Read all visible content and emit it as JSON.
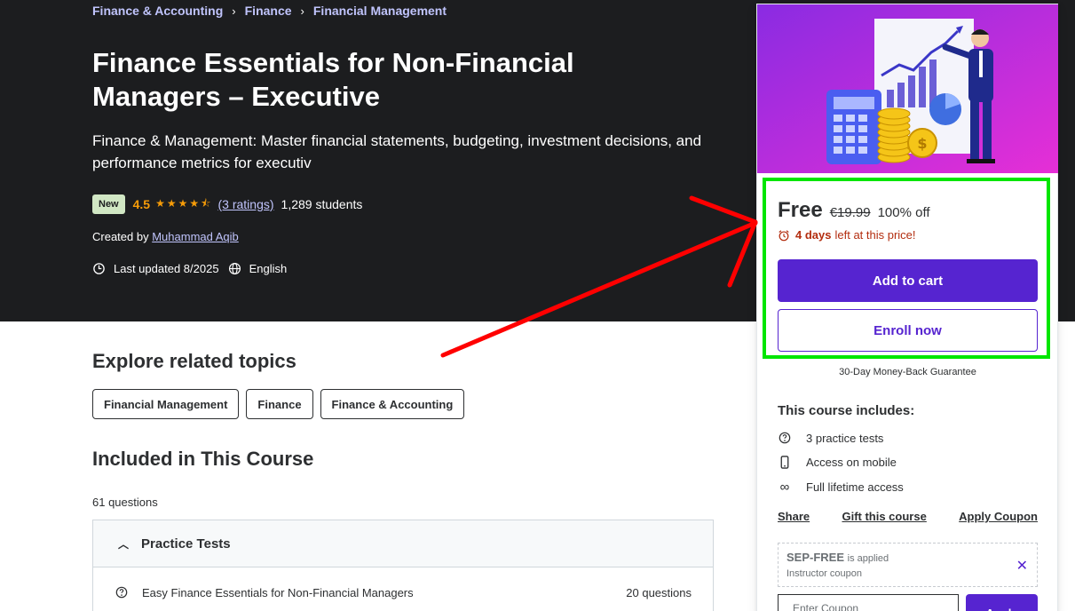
{
  "breadcrumb": [
    "Finance & Accounting",
    "Finance",
    "Financial Management"
  ],
  "course": {
    "title": "Finance Essentials for Non-Financial Managers – Executive",
    "subtitle": "Finance & Management: Master financial statements, budgeting, investment decisions, and performance metrics for executiv",
    "badge": "New",
    "rating": "4.5",
    "rating_stars": 4.5,
    "ratings_link": "(3 ratings)",
    "students": "1,289 students",
    "created_by_label": "Created by",
    "instructor": "Muhammad Aqib",
    "last_updated": "Last updated 8/2025",
    "language": "English"
  },
  "topics": {
    "heading": "Explore related topics",
    "items": [
      "Financial Management",
      "Finance",
      "Finance & Accounting"
    ]
  },
  "included": {
    "heading": "Included in This Course",
    "count": "61 questions",
    "section_title": "Practice Tests",
    "rows": [
      {
        "label": "Easy Finance Essentials for Non-Financial Managers",
        "count": "20 questions"
      }
    ]
  },
  "card": {
    "price": "Free",
    "original_price": "€19.99",
    "discount": "100% off",
    "timer_bold": "4 days",
    "timer_text": "left at this price!",
    "add_to_cart": "Add to cart",
    "enroll": "Enroll now",
    "guarantee": "30-Day Money-Back Guarantee",
    "includes_heading": "This course includes:",
    "includes": [
      {
        "icon": "question-icon",
        "label": "3 practice tests"
      },
      {
        "icon": "mobile-icon",
        "label": "Access on mobile"
      },
      {
        "icon": "infinity-icon",
        "label": "Full lifetime access"
      }
    ],
    "links": [
      "Share",
      "Gift this course",
      "Apply Coupon"
    ],
    "coupon_code": "SEP-FREE",
    "coupon_applied": "is applied",
    "coupon_sub": "Instructor coupon",
    "coupon_placeholder": "Enter Coupon",
    "apply": "Apply"
  },
  "colors": {
    "hero_bg": "#1c1d1f",
    "accent": "#5624d0",
    "link_light": "#c0c4fc",
    "star": "#f69c08",
    "annotation_arrow": "#ff0000",
    "annotation_box": "#00e600"
  }
}
